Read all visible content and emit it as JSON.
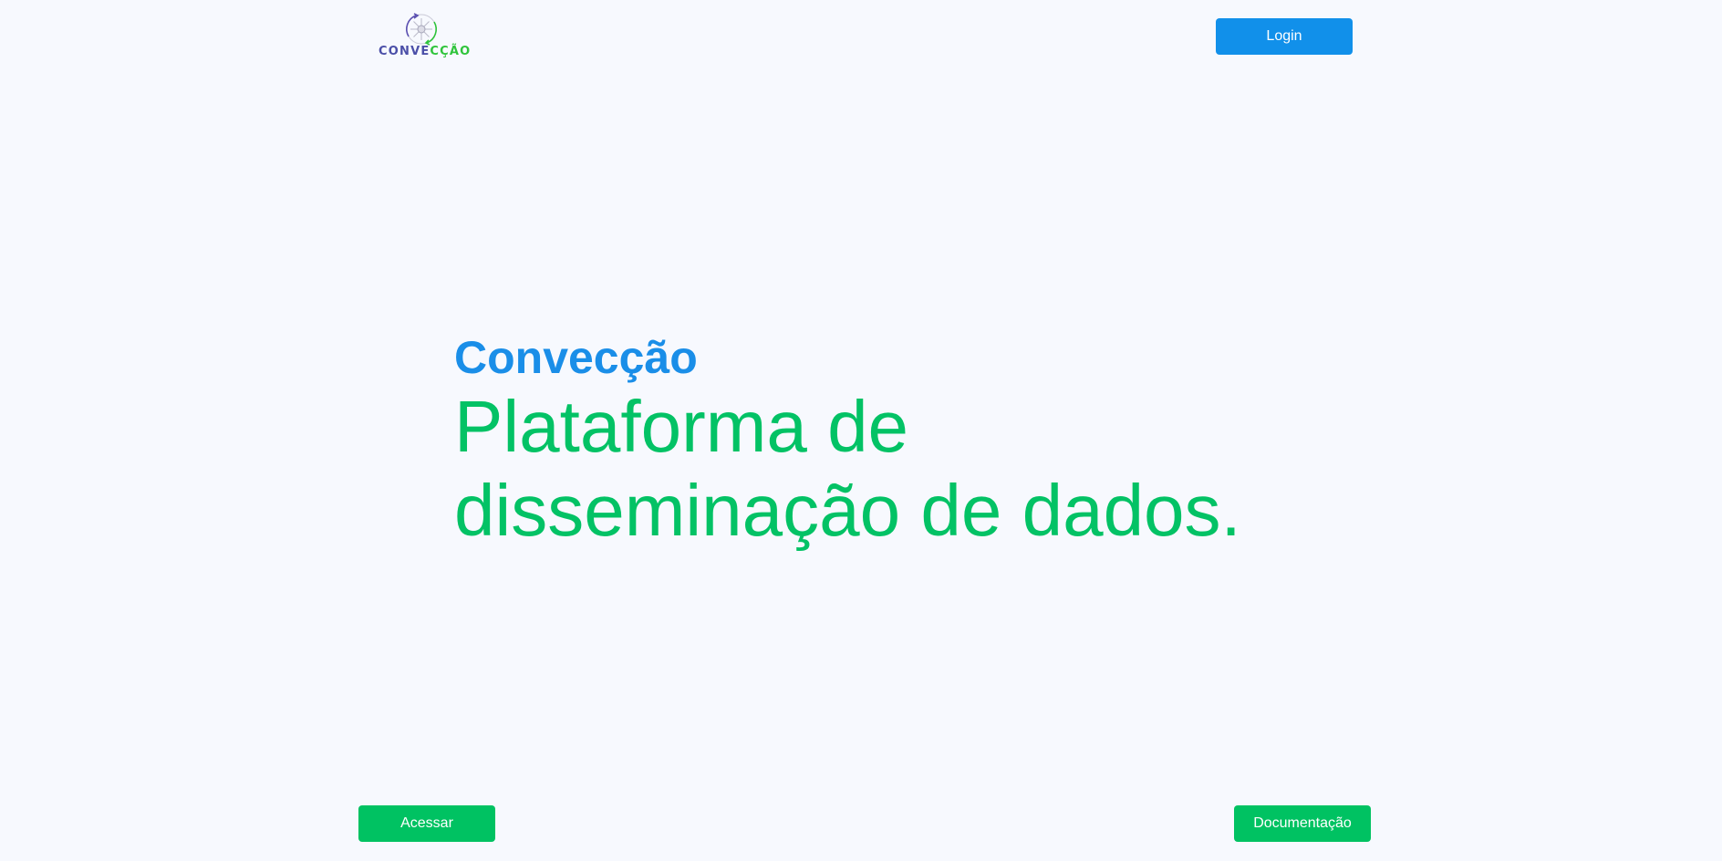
{
  "header": {
    "logo": {
      "icon": "convection-cycle-icon",
      "text_part1": "CONVE",
      "text_part2": "CÇÃO"
    },
    "login_label": "Login"
  },
  "hero": {
    "brand": "Convecção",
    "title": "Plataforma de disseminação de dados."
  },
  "footer": {
    "access_label": "Acessar",
    "docs_label": "Documentação"
  },
  "colors": {
    "background": "#f7f9fe",
    "primary_blue": "#1190ea",
    "accent_green": "#00c262",
    "logo_purple": "#4b4fa8",
    "logo_green": "#2fc43b"
  }
}
